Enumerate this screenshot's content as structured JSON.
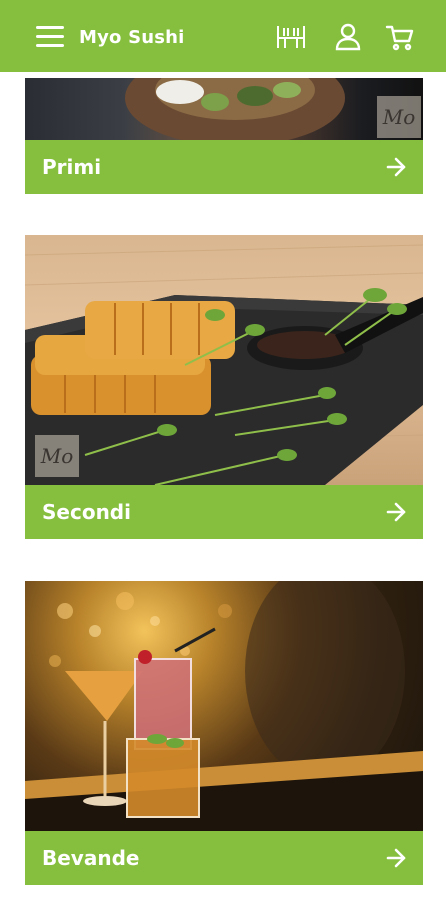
{
  "header": {
    "title": "Myo Sushi"
  },
  "categories": [
    {
      "label": "Primi"
    },
    {
      "label": "Secondi"
    },
    {
      "label": "Bevande"
    }
  ],
  "badge": {
    "text": "Mo"
  },
  "colors": {
    "brand_green": "#86bf3e",
    "white": "#ffffff"
  }
}
